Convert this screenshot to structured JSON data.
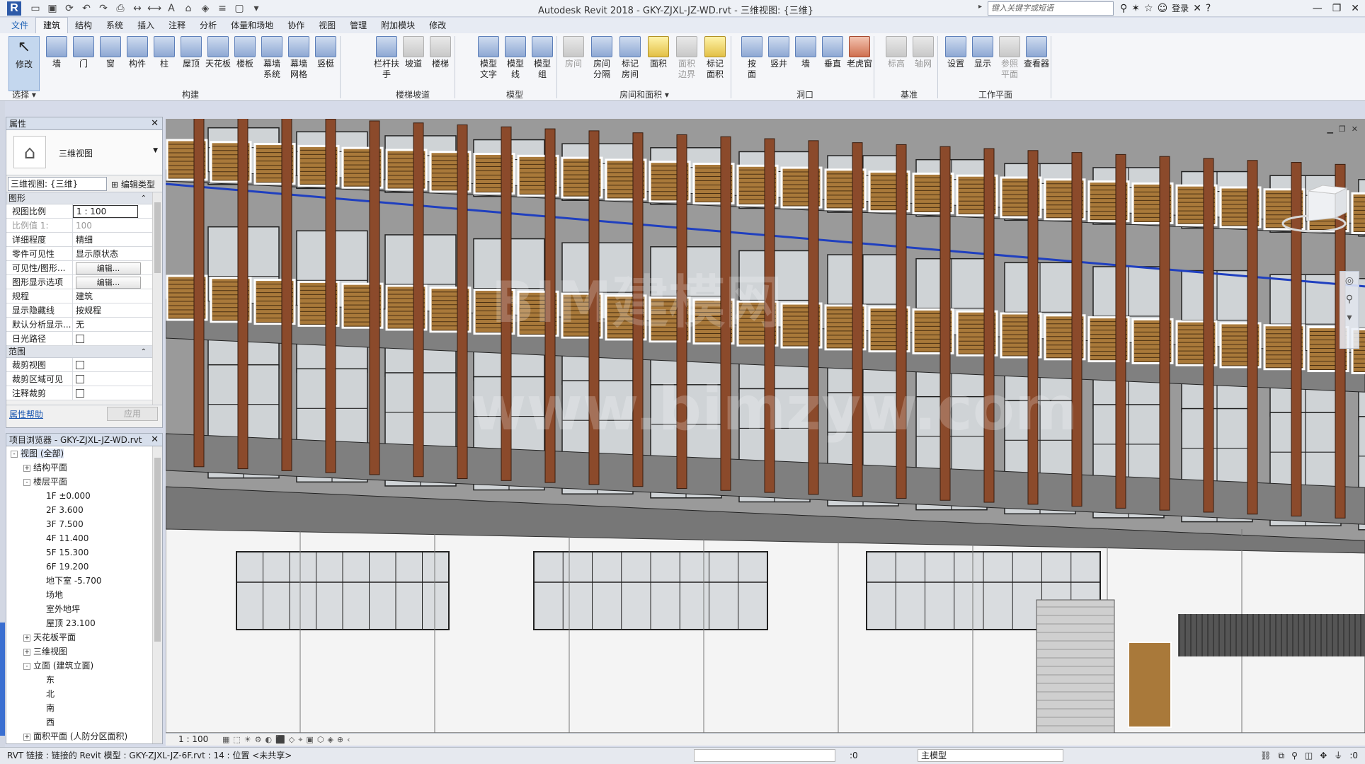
{
  "app": {
    "title": "Autodesk Revit 2018 -    GKY-ZJXL-JZ-WD.rvt - 三维视图: {三维}",
    "search_placeholder": "键入关键字或短语",
    "login": "登录"
  },
  "tabs": [
    "文件",
    "建筑",
    "结构",
    "系统",
    "插入",
    "注释",
    "分析",
    "体量和场地",
    "协作",
    "视图",
    "管理",
    "附加模块",
    "修改"
  ],
  "active_tab": "建筑",
  "ribbon": {
    "modify": "修改",
    "select": "选择 ▾",
    "build_tools": [
      "墙",
      "门",
      "窗",
      "构件",
      "柱",
      "屋顶",
      "天花板",
      "楼板",
      "幕墙\n系统",
      "幕墙\n网格",
      "竖梃"
    ],
    "build_label": "构建",
    "stair_tools": [
      "栏杆扶手",
      "坡道",
      "楼梯"
    ],
    "stair_label": "楼梯坡道",
    "model_tools": [
      "模型\n文字",
      "模型\n线",
      "模型\n组"
    ],
    "model_label": "模型",
    "room_tools": [
      "房间",
      "房间\n分隔",
      "标记\n房间",
      "面积",
      "面积\n边界",
      "标记\n面积"
    ],
    "room_label": "房间和面积 ▾",
    "opening_tools": [
      "按\n面",
      "竖井",
      "墙",
      "垂直",
      "老虎窗"
    ],
    "opening_label": "洞口",
    "datum_tools": [
      "标高",
      "轴网"
    ],
    "datum_label": "基准",
    "workplane_tools": [
      "设置",
      "显示",
      "参照\n平面",
      "查看器"
    ],
    "workplane_label": "工作平面"
  },
  "properties": {
    "title": "属性",
    "type_name": "三维视图",
    "view_select": "三维视图: {三维}",
    "edit_type": "编辑类型",
    "section_graphics": "图形",
    "rows": [
      {
        "k": "视图比例",
        "v": "1 : 100",
        "style": "boxed"
      },
      {
        "k": "比例值 1:",
        "v": "100",
        "style": "dim"
      },
      {
        "k": "详细程度",
        "v": "精细"
      },
      {
        "k": "零件可见性",
        "v": "显示原状态"
      },
      {
        "k": "可见性/图形...",
        "v": "编辑...",
        "style": "btn"
      },
      {
        "k": "图形显示选项",
        "v": "编辑...",
        "style": "btn"
      },
      {
        "k": "规程",
        "v": "建筑"
      },
      {
        "k": "显示隐藏线",
        "v": "按规程"
      },
      {
        "k": "默认分析显示...",
        "v": "无"
      },
      {
        "k": "日光路径",
        "v": "",
        "style": "chk"
      }
    ],
    "section_extents": "范围",
    "rows2": [
      {
        "k": "裁剪视图",
        "v": "",
        "style": "chk"
      },
      {
        "k": "裁剪区域可见",
        "v": "",
        "style": "chk"
      },
      {
        "k": "注释裁剪",
        "v": "",
        "style": "chk"
      }
    ],
    "help": "属性帮助",
    "apply": "应用"
  },
  "browser": {
    "title": "项目浏览器 - GKY-ZJXL-JZ-WD.rvt",
    "nodes": [
      {
        "label": "视图 (全部)",
        "indent": 0,
        "exp": "-",
        "sel": true
      },
      {
        "label": "结构平面",
        "indent": 1,
        "exp": "+"
      },
      {
        "label": "楼层平面",
        "indent": 1,
        "exp": "-"
      },
      {
        "label": "1F ±0.000",
        "indent": 2
      },
      {
        "label": "2F 3.600",
        "indent": 2
      },
      {
        "label": "3F 7.500",
        "indent": 2
      },
      {
        "label": "4F 11.400",
        "indent": 2
      },
      {
        "label": "5F 15.300",
        "indent": 2
      },
      {
        "label": "6F 19.200",
        "indent": 2
      },
      {
        "label": "地下室 -5.700",
        "indent": 2
      },
      {
        "label": "场地",
        "indent": 2
      },
      {
        "label": "室外地坪",
        "indent": 2
      },
      {
        "label": "屋顶 23.100",
        "indent": 2
      },
      {
        "label": "天花板平面",
        "indent": 1,
        "exp": "+"
      },
      {
        "label": "三维视图",
        "indent": 1,
        "exp": "+"
      },
      {
        "label": "立面 (建筑立面)",
        "indent": 1,
        "exp": "-"
      },
      {
        "label": "东",
        "indent": 2
      },
      {
        "label": "北",
        "indent": 2
      },
      {
        "label": "南",
        "indent": 2
      },
      {
        "label": "西",
        "indent": 2
      },
      {
        "label": "面积平面 (人防分区面积)",
        "indent": 1,
        "exp": "+"
      }
    ]
  },
  "viewport": {
    "watermark_1": "BIM建模网",
    "watermark_2": "www.bimzyw.com"
  },
  "viewbar": {
    "scale": "1 : 100"
  },
  "status": {
    "message": "RVT 链接 : 链接的 Revit 模型 : GKY-ZJXL-JZ-6F.rvt : 14 : 位置 <未共享>",
    "coord": ":0",
    "model": "主模型",
    "filter": ":0"
  },
  "colors": {
    "accent": "#2d5aa8",
    "wall_grey": "#7a7a7a",
    "column_brown": "#8b4a2b",
    "louver": "#a9793a",
    "blue_line": "#1f3fbf"
  }
}
